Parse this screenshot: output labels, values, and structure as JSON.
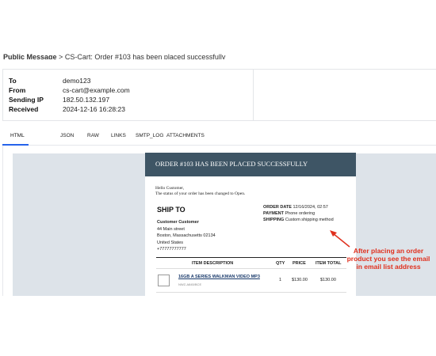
{
  "header": {
    "label": "Public Message",
    "separator": ">",
    "subject": "CS-Cart: Order #103 has been placed successfully"
  },
  "message_info": [
    {
      "key": "To",
      "value": "demo123"
    },
    {
      "key": "From",
      "value": "cs-cart@example.com"
    },
    {
      "key": "Sending IP",
      "value": "182.50.132.197"
    },
    {
      "key": "Received",
      "value": "2024-12-16 16:28:23"
    }
  ],
  "tabs": [
    {
      "label": "HTML",
      "active": true
    },
    {
      "label": "JSON",
      "active": false
    },
    {
      "label": "RAW",
      "active": false
    },
    {
      "label": "LINKS",
      "active": false
    },
    {
      "label": "SMTP_LOG",
      "active": false
    },
    {
      "label": "ATTACHMENTS",
      "active": false
    }
  ],
  "email": {
    "title": "ORDER #103 HAS BEEN PLACED SUCCESSFULLY",
    "greeting": "Hello Customer,",
    "status_line": "The status of your order has been changed to Open.",
    "ship_to_heading": "SHIP TO",
    "order_date_label": "ORDER DATE",
    "order_date_value": "12/16/2024, 02:57",
    "payment_label": "PAYMENT",
    "payment_value": "Phone ordering",
    "shipping_label": "SHIPPING",
    "shipping_value": "Custom shipping method",
    "address": {
      "name": "Customer Customer",
      "street": "44 Main street",
      "city": "Boston, Massachusetts 02134",
      "country": "United States",
      "phone": "+77777777777"
    },
    "table": {
      "headers": [
        "ITEM DESCRIPTION",
        "QTY",
        "PRICE",
        "ITEM TOTAL"
      ],
      "rows": [
        {
          "name": "16GB A SERIES WALKMAN VIDEO MP3",
          "code": "NWZ-A845/BCE",
          "qty": "1",
          "price": "$130.00",
          "total": "$130.00"
        }
      ]
    }
  },
  "annotation": {
    "text": "After placing an order product you see the email in email list address",
    "color": "#e0301e"
  },
  "colors": {
    "email_header": "#3e5565",
    "preview_background": "#dde3e9",
    "tab_active": "#2563eb"
  }
}
